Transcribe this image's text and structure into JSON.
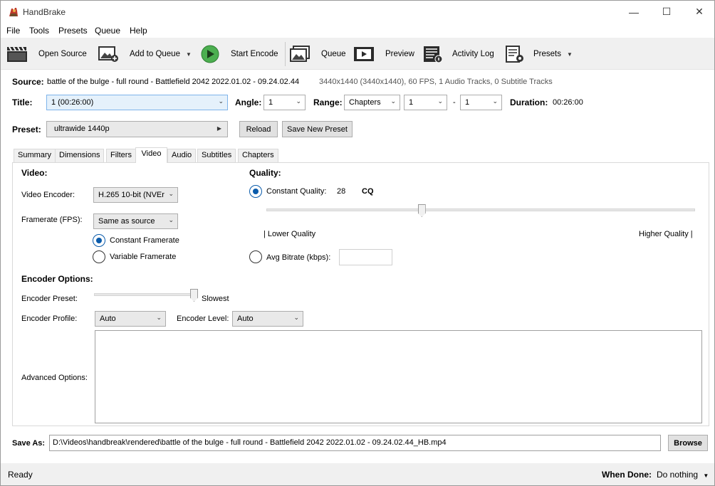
{
  "window": {
    "title": "HandBrake",
    "controls": {
      "minimize": "—",
      "maximize": "☐",
      "close": "✕"
    }
  },
  "menu": [
    "File",
    "Tools",
    "Presets",
    "Queue",
    "Help"
  ],
  "toolbar": {
    "open_source": "Open Source",
    "add_to_queue": "Add to Queue",
    "start_encode": "Start Encode",
    "queue": "Queue",
    "preview": "Preview",
    "activity_log": "Activity Log",
    "presets": "Presets"
  },
  "source": {
    "label": "Source:",
    "name": "battle of the bulge - full round - Battlefield 2042 2022.01.02 - 09.24.02.44",
    "info": "3440x1440 (3440x1440), 60 FPS, 1 Audio Tracks, 0 Subtitle Tracks"
  },
  "title_row": {
    "title_label": "Title:",
    "title_value": "1  (00:26:00)",
    "angle_label": "Angle:",
    "angle_value": "1",
    "range_label": "Range:",
    "range_type": "Chapters",
    "range_start": "1",
    "range_dash": "-",
    "range_end": "1",
    "duration_label": "Duration:",
    "duration_value": "00:26:00"
  },
  "preset_row": {
    "label": "Preset:",
    "value": "ultrawide 1440p",
    "reload": "Reload",
    "save_new": "Save New Preset"
  },
  "tabs": [
    "Summary",
    "Dimensions",
    "Filters",
    "Video",
    "Audio",
    "Subtitles",
    "Chapters"
  ],
  "active_tab": "Video",
  "video": {
    "section_title": "Video:",
    "encoder_label": "Video Encoder:",
    "encoder_value": "H.265 10-bit (NVEr",
    "framerate_label": "Framerate (FPS):",
    "framerate_value": "Same as source",
    "constant_framerate": "Constant Framerate",
    "variable_framerate": "Variable Framerate",
    "constant_framerate_selected": true
  },
  "quality": {
    "section_title": "Quality:",
    "constant_quality_label": "Constant Quality:",
    "constant_quality_value": "28",
    "constant_quality_unit": "CQ",
    "slider_fraction": 0.36,
    "lower_label": "| Lower Quality",
    "higher_label": "Higher Quality |",
    "avg_bitrate_label": "Avg Bitrate (kbps):",
    "avg_bitrate_value": ""
  },
  "encoder_options": {
    "section_title": "Encoder Options:",
    "preset_label": "Encoder Preset:",
    "preset_value_label": "Slowest",
    "preset_slider_fraction": 1.0,
    "profile_label": "Encoder Profile:",
    "profile_value": "Auto",
    "level_label": "Encoder Level:",
    "level_value": "Auto",
    "advanced_label": "Advanced Options:",
    "advanced_value": ""
  },
  "save_as": {
    "label": "Save As:",
    "path": "D:\\Videos\\handbreak\\rendered\\battle of the bulge - full round - Battlefield 2042 2022.01.02 - 09.24.02.44_HB.mp4",
    "browse": "Browse"
  },
  "status": {
    "text": "Ready",
    "when_done_label": "When Done:",
    "when_done_value": "Do nothing"
  },
  "colors": {
    "accent": "#0a5bab",
    "toolbar_bg": "#f0f0f0",
    "start_green": "#4caf50"
  }
}
